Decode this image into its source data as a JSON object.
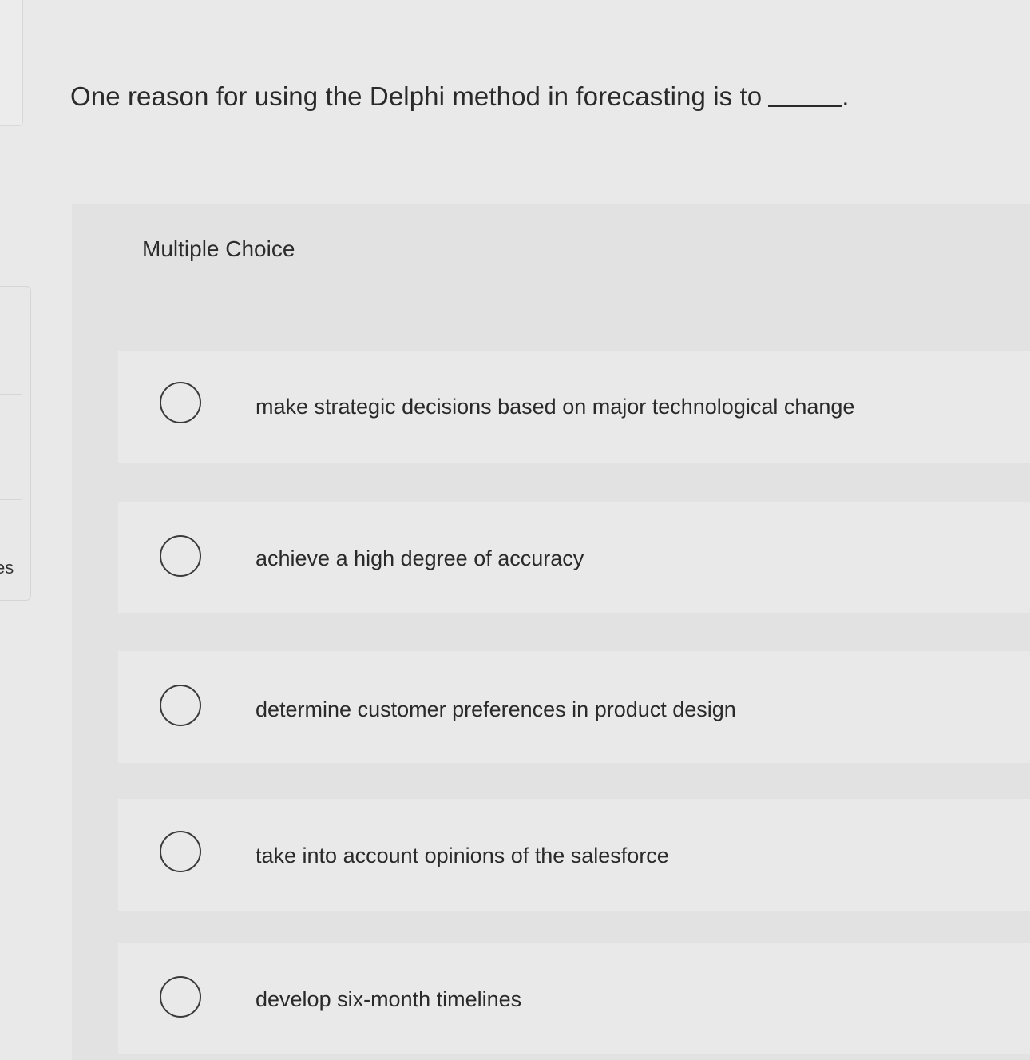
{
  "sidebar": {
    "partial_label": "es"
  },
  "question": {
    "text": "One reason for using the Delphi method in forecasting is to",
    "end_punctuation": "."
  },
  "panel": {
    "label": "Multiple Choice"
  },
  "options": [
    {
      "label": "make strategic decisions based on major technological change"
    },
    {
      "label": "achieve a high degree of accuracy"
    },
    {
      "label": "determine customer preferences in product design"
    },
    {
      "label": "take into account opinions of the salesforce"
    },
    {
      "label": "develop six-month timelines"
    }
  ]
}
